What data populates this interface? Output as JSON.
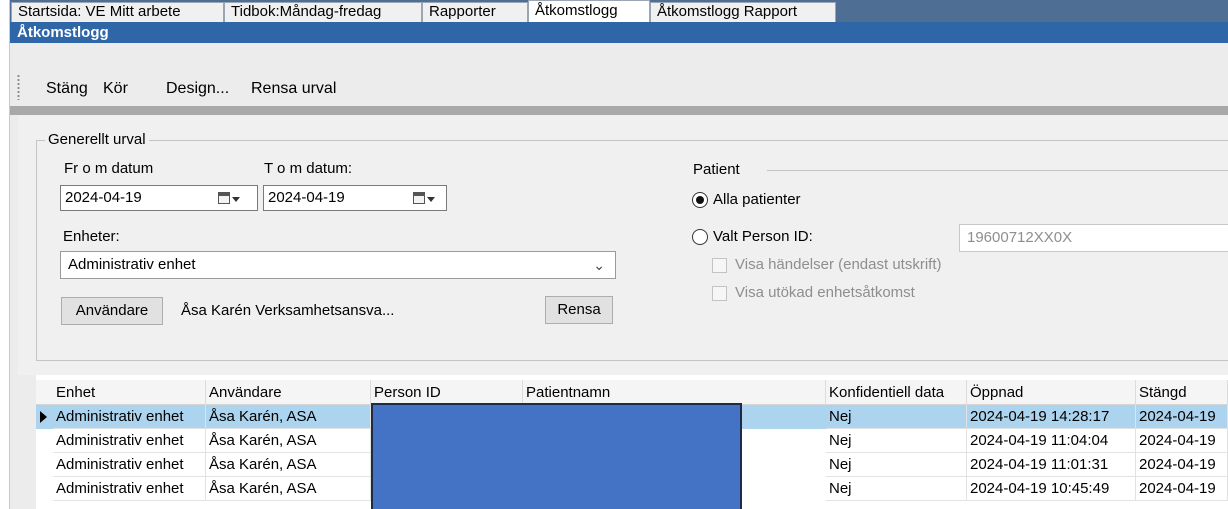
{
  "tabs": [
    {
      "label": "Startsida: VE Mitt arbete",
      "active": false
    },
    {
      "label": "Tidbok:Måndag-fredag",
      "active": false
    },
    {
      "label": "Rapporter",
      "active": false
    },
    {
      "label": "Åtkomstlogg",
      "active": true
    },
    {
      "label": "Åtkomstlogg Rapport",
      "active": false
    }
  ],
  "window": {
    "title": "Åtkomstlogg"
  },
  "toolbar": {
    "close": "Stäng",
    "run": "Kör",
    "design": "Design...",
    "clear": "Rensa urval"
  },
  "filters": {
    "group_title": "Generellt urval",
    "from_label": "Fr o m datum",
    "from_value": "2024-04-19",
    "to_label": "T o m datum:",
    "to_value": "2024-04-19",
    "units_label": "Enheter:",
    "units_value": "Administrativ enhet",
    "user_button": "Användare",
    "user_value": "Åsa Karén Verksamhetsansva...",
    "clear_button": "Rensa"
  },
  "patient": {
    "title": "Patient",
    "all_label": "Alla patienter",
    "all_selected": true,
    "chosen_label": "Valt Person ID:",
    "person_id_placeholder": "19600712XX0X",
    "show_events": "Visa händelser (endast utskrift)",
    "show_extended": "Visa utökad enhetsåtkomst"
  },
  "grid": {
    "columns": [
      "Enhet",
      "Användare",
      "Person ID",
      "Patientnamn",
      "Konfidentiell data",
      "Öppnad",
      "Stängd"
    ],
    "rows": [
      {
        "enhet": "Administrativ enhet",
        "anvandare": "Åsa Karén, ASA",
        "konf": "Nej",
        "oppnad": "2024-04-19 14:28:17",
        "stangd": "2024-04-19"
      },
      {
        "enhet": "Administrativ enhet",
        "anvandare": "Åsa Karén, ASA",
        "konf": "Nej",
        "oppnad": "2024-04-19 11:04:04",
        "stangd": "2024-04-19"
      },
      {
        "enhet": "Administrativ enhet",
        "anvandare": "Åsa Karén, ASA",
        "konf": "Nej",
        "oppnad": "2024-04-19 11:01:31",
        "stangd": "2024-04-19"
      },
      {
        "enhet": "Administrativ enhet",
        "anvandare": "Åsa Karén, ASA",
        "konf": "Nej",
        "oppnad": "2024-04-19 10:45:49",
        "stangd": "2024-04-19"
      }
    ],
    "selected_row": 0
  },
  "colors": {
    "tabbar": "#4f6e93",
    "titlebar": "#2f66a8",
    "selection": "#add4ee",
    "redaction": "#4472c4"
  }
}
